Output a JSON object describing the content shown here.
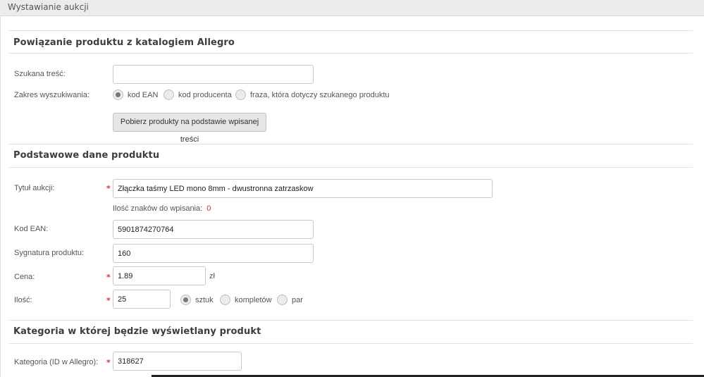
{
  "window": {
    "title": "Wystawianie aukcji"
  },
  "section_catalog": {
    "title": "Powiązanie produktu z katalogiem Allegro",
    "search_label": "Szukana treść:",
    "search_value": "",
    "scope_label": "Zakres wyszukiwania:",
    "scope_options": [
      "kod EAN",
      "kod producenta",
      "fraza, która dotyczy szukanego produktu"
    ],
    "scope_selected": "kod EAN",
    "fetch_button": "Pobierz produkty na podstawie wpisanej treści"
  },
  "section_basic": {
    "title": "Podstawowe dane produktu",
    "title_label": "Tytuł aukcji:",
    "title_value": "Złączka taśmy LED mono 8mm - dwustronna zatrzaskow",
    "chars_left_label": "Ilość znaków do wpisania:",
    "chars_left_value": "0",
    "ean_label": "Kod EAN:",
    "ean_value": "5901874270764",
    "signature_label": "Sygnatura produktu:",
    "signature_value": "160",
    "price_label": "Cena:",
    "price_value": "1.89",
    "price_unit": "zł",
    "qty_label": "Ilość:",
    "qty_value": "25",
    "qty_units": [
      "sztuk",
      "kompletów",
      "par"
    ],
    "qty_unit_selected": "sztuk"
  },
  "section_category": {
    "title": "Kategoria w której będzie wyświetlany produkt",
    "category_label": "Kategoria (ID w Allegro):",
    "category_value": "318627"
  },
  "required_mark": "*",
  "colors": {
    "required": "#e03030",
    "accent_text": "#3d3d3d",
    "border": "#c8c8c8"
  }
}
